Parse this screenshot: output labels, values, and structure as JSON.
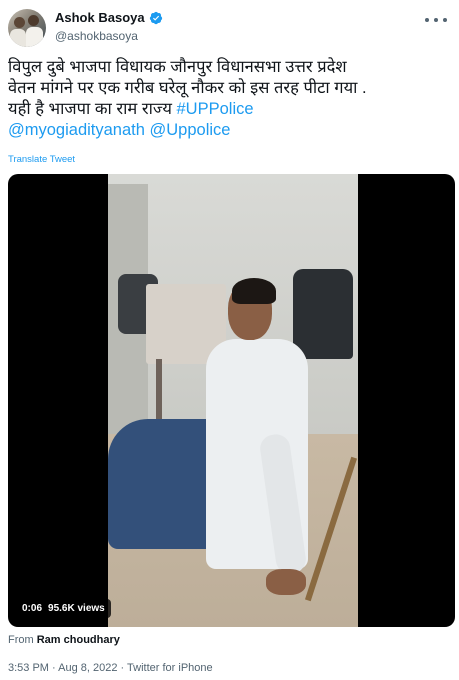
{
  "author": {
    "display_name": "Ashok Basoya",
    "handle": "@ashokbasoya",
    "verified": true,
    "avatar_icon": "profile-photo"
  },
  "tweet": {
    "lines": [
      "विपुल दुबे भाजपा विधायक जौनपुर विधानसभा उत्तर प्रदेश",
      "वेतन मांगने पर एक गरीब घरेलू नौकर को इस तरह पीटा गया ."
    ],
    "line3_prefix": "यही है भाजपा का राम राज्य ",
    "hashtag": "#UPPolice",
    "mention_1": "@myogiadityanath",
    "mention_2": "@Uppolice",
    "translate_label": "Translate Tweet"
  },
  "media": {
    "duration": "0:06",
    "views": "95.6K views"
  },
  "attribution": {
    "prefix": "From ",
    "source": "Ram choudhary"
  },
  "meta": {
    "timestamp": "3:53 PM · Aug 8, 2022 · Twitter for iPhone"
  },
  "colors": {
    "accent": "#1d9bf0",
    "text": "#0f1419",
    "muted": "#536471"
  }
}
